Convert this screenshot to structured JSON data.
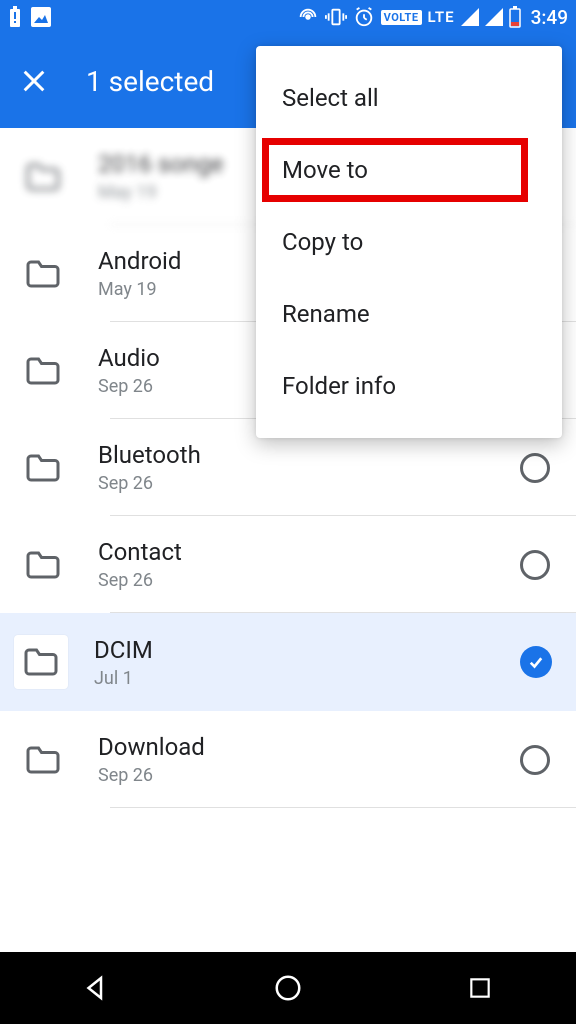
{
  "status_bar": {
    "volte": "VOLTE",
    "network_label": "LTE",
    "time": "3:49"
  },
  "app_bar": {
    "title": "1 selected"
  },
  "folders": [
    {
      "name": "2016 songe",
      "date": "May 19",
      "selected": false,
      "blurred": true
    },
    {
      "name": "Android",
      "date": "May 19",
      "selected": false,
      "blurred": false
    },
    {
      "name": "Audio",
      "date": "Sep 26",
      "selected": false,
      "blurred": false
    },
    {
      "name": "Bluetooth",
      "date": "Sep 26",
      "selected": false,
      "blurred": false
    },
    {
      "name": "Contact",
      "date": "Sep 26",
      "selected": false,
      "blurred": false
    },
    {
      "name": "DCIM",
      "date": "Jul 1",
      "selected": true,
      "blurred": false
    },
    {
      "name": "Download",
      "date": "Sep 26",
      "selected": false,
      "blurred": false
    }
  ],
  "menu": {
    "items": [
      {
        "label": "Select all",
        "highlight": false
      },
      {
        "label": "Move to",
        "highlight": true
      },
      {
        "label": "Copy to",
        "highlight": false
      },
      {
        "label": "Rename",
        "highlight": false
      },
      {
        "label": "Folder info",
        "highlight": false
      }
    ]
  }
}
